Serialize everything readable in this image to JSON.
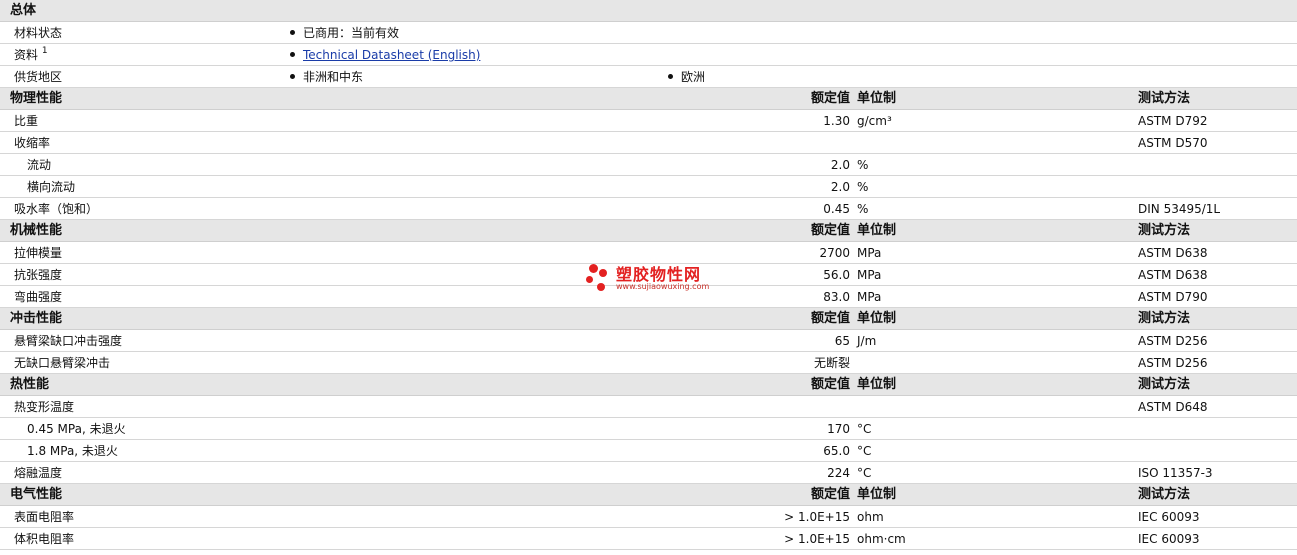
{
  "general": {
    "title": "总体",
    "material_status_label": "材料状态",
    "material_status_value": "已商用：当前有效",
    "documents_label": "资料",
    "documents_sup": "1",
    "documents_link": "Technical Datasheet (English)",
    "availability_label": "供货地区",
    "availability_values": [
      "非洲和中东",
      "欧洲"
    ]
  },
  "column_headers": {
    "value": "额定值",
    "unit": "单位制",
    "test": "测试方法"
  },
  "sections": [
    {
      "title": "物理性能",
      "rows": [
        {
          "name": "比重",
          "value": "1.30",
          "unit": "g/cm³",
          "test": "ASTM D792",
          "indent": false
        },
        {
          "name": "收缩率",
          "value": "",
          "unit": "",
          "test": "ASTM D570",
          "indent": false
        },
        {
          "name": "流动",
          "value": "2.0",
          "unit": "%",
          "test": "",
          "indent": true
        },
        {
          "name": "横向流动",
          "value": "2.0",
          "unit": "%",
          "test": "",
          "indent": true
        },
        {
          "name": "吸水率（饱和）",
          "value": "0.45",
          "unit": "%",
          "test": "DIN 53495/1L",
          "indent": false
        }
      ]
    },
    {
      "title": "机械性能",
      "rows": [
        {
          "name": "拉伸模量",
          "value": "2700",
          "unit": "MPa",
          "test": "ASTM D638",
          "indent": false
        },
        {
          "name": "抗张强度",
          "value": "56.0",
          "unit": "MPa",
          "test": "ASTM D638",
          "indent": false
        },
        {
          "name": "弯曲强度",
          "value": "83.0",
          "unit": "MPa",
          "test": "ASTM D790",
          "indent": false
        }
      ]
    },
    {
      "title": "冲击性能",
      "rows": [
        {
          "name": "悬臂梁缺口冲击强度",
          "value": "65",
          "unit": "J/m",
          "test": "ASTM D256",
          "indent": false
        },
        {
          "name": "无缺口悬臂梁冲击",
          "value": "无断裂",
          "unit": "",
          "test": "ASTM D256",
          "indent": false
        }
      ]
    },
    {
      "title": "热性能",
      "rows": [
        {
          "name": "热变形温度",
          "value": "",
          "unit": "",
          "test": "ASTM D648",
          "indent": false
        },
        {
          "name": "0.45 MPa, 未退火",
          "value": "170",
          "unit": "°C",
          "test": "",
          "indent": true
        },
        {
          "name": "1.8 MPa, 未退火",
          "value": "65.0",
          "unit": "°C",
          "test": "",
          "indent": true
        },
        {
          "name": "熔融温度",
          "value": "224",
          "unit": "°C",
          "test": "ISO 11357-3",
          "indent": false
        }
      ]
    },
    {
      "title": "电气性能",
      "rows": [
        {
          "name": "表面电阻率",
          "value": "> 1.0E+15",
          "unit": "ohm",
          "test": "IEC 60093",
          "indent": false
        },
        {
          "name": "体积电阻率",
          "value": "> 1.0E+15",
          "unit": "ohm·cm",
          "test": "IEC 60093",
          "indent": false
        }
      ]
    }
  ],
  "watermark": {
    "brand": "塑胶物性网",
    "url": "www.sujiaowuxing.com",
    "color": "#e32121"
  }
}
